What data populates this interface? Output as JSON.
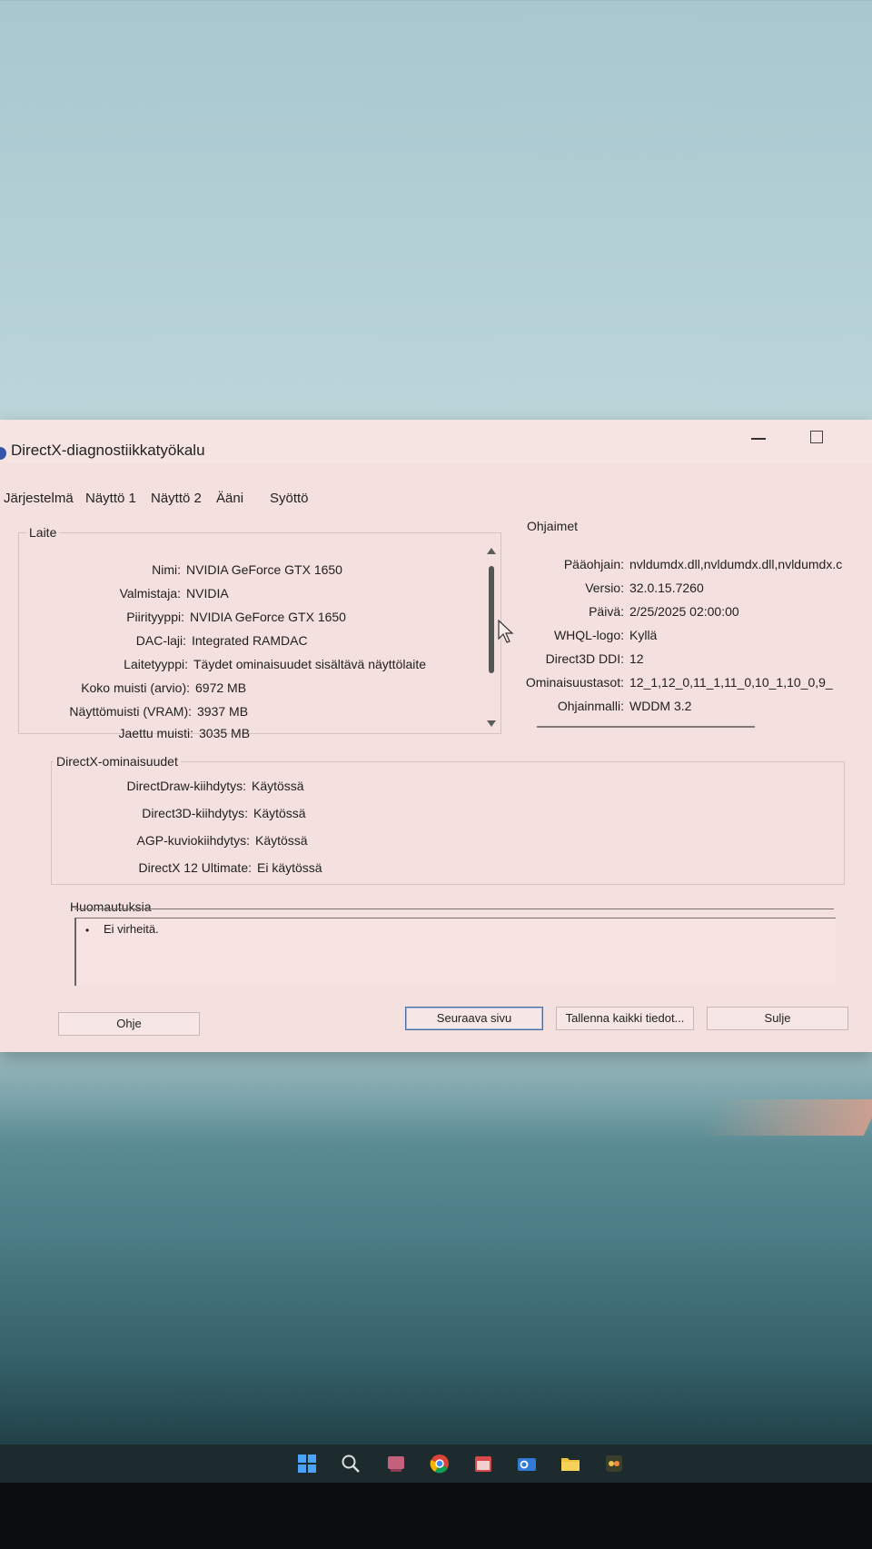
{
  "window": {
    "title": "DirectX-diagnostiikkatyökalu"
  },
  "tabs": [
    "Järjestelmä",
    "Näyttö 1",
    "Näyttö 2",
    "Ääni",
    "Syöttö"
  ],
  "device": {
    "title": "Laite",
    "rows": [
      {
        "label": "Nimi:",
        "value": "NVIDIA GeForce GTX 1650"
      },
      {
        "label": "Valmistaja:",
        "value": "NVIDIA"
      },
      {
        "label": "Piirityyppi:",
        "value": "NVIDIA GeForce GTX 1650"
      },
      {
        "label": "DAC-laji:",
        "value": "Integrated RAMDAC"
      },
      {
        "label": "Laitetyyppi:",
        "value": "Täydet ominaisuudet sisältävä näyttölaite"
      },
      {
        "label": "Koko muisti (arvio):",
        "value": "6972 MB"
      },
      {
        "label": "Näyttömuisti (VRAM):",
        "value": "3937 MB"
      },
      {
        "label": "Jaettu muisti:",
        "value": "3035 MB"
      }
    ]
  },
  "drivers": {
    "title": "Ohjaimet",
    "rows": [
      {
        "label": "Pääohjain:",
        "value": "nvldumdx.dll,nvldumdx.dll,nvldumdx.c"
      },
      {
        "label": "Versio:",
        "value": "32.0.15.7260"
      },
      {
        "label": "Päivä:",
        "value": "2/25/2025 02:00:00"
      },
      {
        "label": "WHQL-logo:",
        "value": "Kyllä"
      },
      {
        "label": "Direct3D DDI:",
        "value": "12"
      },
      {
        "label": "Ominaisuustasot:",
        "value": "12_1,12_0,11_1,11_0,10_1,10_0,9_"
      },
      {
        "label": "Ohjainmalli:",
        "value": "WDDM 3.2"
      }
    ]
  },
  "features": {
    "title": "DirectX-ominaisuudet",
    "rows": [
      {
        "label": "DirectDraw-kiihdytys:",
        "value": "Käytössä"
      },
      {
        "label": "Direct3D-kiihdytys:",
        "value": "Käytössä"
      },
      {
        "label": "AGP-kuviokiihdytys:",
        "value": "Käytössä"
      },
      {
        "label": "DirectX 12 Ultimate:",
        "value": "Ei käytössä"
      }
    ]
  },
  "notes": {
    "title": "Huomautuksia",
    "items": [
      "Ei virheitä."
    ]
  },
  "buttons": {
    "help": "Ohje",
    "next": "Seuraava sivu",
    "save": "Tallenna kaikki tiedot...",
    "close": "Sulje"
  },
  "taskbar": {
    "icons": [
      "windows-start-icon",
      "search-icon",
      "app-icon",
      "chrome-icon",
      "calendar-icon",
      "outlook-icon",
      "file-explorer-icon",
      "app-icon"
    ]
  }
}
